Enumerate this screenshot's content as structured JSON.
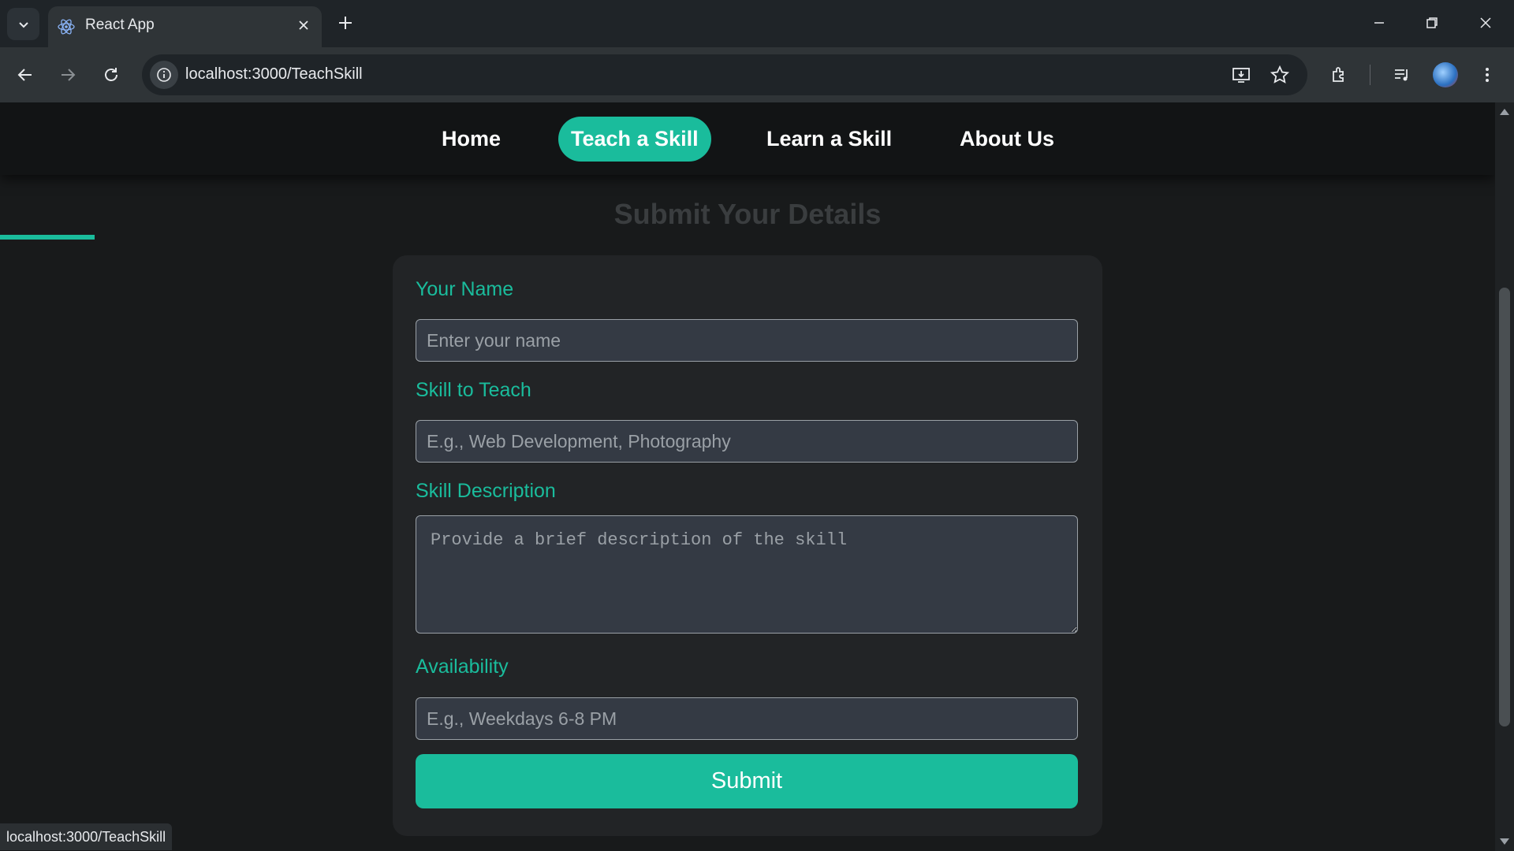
{
  "browser": {
    "tab_title": "React App",
    "url": "localhost:3000/TeachSkill",
    "status_url": "localhost:3000/TeachSkill"
  },
  "nav": {
    "items": [
      {
        "label": "Home",
        "active": false
      },
      {
        "label": "Teach a Skill",
        "active": true
      },
      {
        "label": "Learn a Skill",
        "active": false
      },
      {
        "label": "About Us",
        "active": false
      }
    ]
  },
  "page": {
    "title": "Submit Your Details"
  },
  "form": {
    "name_label": "Your Name",
    "name_placeholder": "Enter your name",
    "skill_label": "Skill to Teach",
    "skill_placeholder": "E.g., Web Development, Photography",
    "description_label": "Skill Description",
    "description_placeholder": "Provide a brief description of the skill",
    "availability_label": "Availability",
    "availability_placeholder": "E.g., Weekdays 6-8 PM",
    "submit_label": "Submit"
  },
  "colors": {
    "accent": "#1abc9c",
    "background": "#181a1b",
    "card": "#222426",
    "input": "#343a44"
  }
}
